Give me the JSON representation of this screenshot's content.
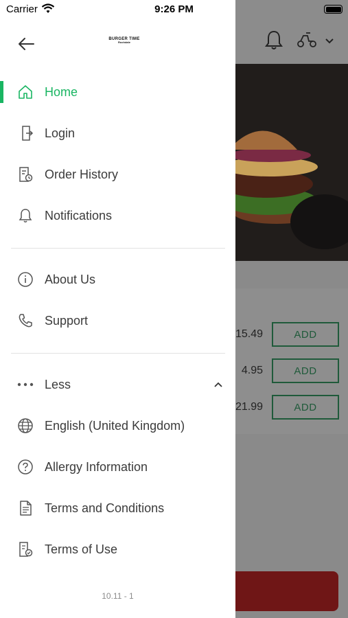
{
  "status_bar": {
    "carrier": "Carrier",
    "time": "9:26 PM"
  },
  "drawer": {
    "logo_main": "BURGER TIME",
    "logo_sub": "Rochdale",
    "items_primary": [
      {
        "label": "Home",
        "icon": "home-icon",
        "active": true
      },
      {
        "label": "Login",
        "icon": "login-icon",
        "active": false
      },
      {
        "label": "Order History",
        "icon": "order-history-icon",
        "active": false
      },
      {
        "label": "Notifications",
        "icon": "bell-icon",
        "active": false
      }
    ],
    "items_secondary": [
      {
        "label": "About Us",
        "icon": "info-icon"
      },
      {
        "label": "Support",
        "icon": "phone-icon"
      }
    ],
    "less_label": "Less",
    "items_more": [
      {
        "label": "English (United Kingdom)",
        "icon": "globe-icon"
      },
      {
        "label": "Allergy Information",
        "icon": "question-icon"
      },
      {
        "label": "Terms and Conditions",
        "icon": "document-icon"
      },
      {
        "label": "Terms of Use",
        "icon": "document-check-icon"
      }
    ],
    "version": "10.11 - 1"
  },
  "background": {
    "prices": [
      "15.49",
      "4.95",
      "21.99"
    ],
    "add_label": "ADD"
  },
  "colors": {
    "accent": "#19b562",
    "text": "#3b3b3b",
    "overlay": "#8a8a8a"
  }
}
